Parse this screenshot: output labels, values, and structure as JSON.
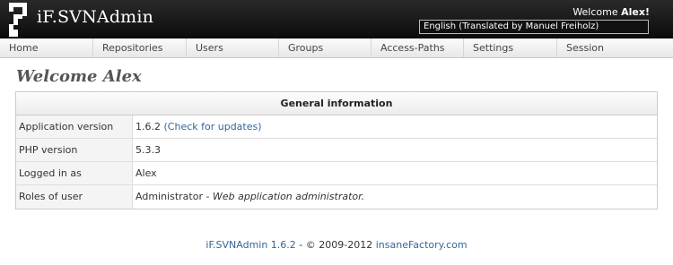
{
  "header": {
    "app_name": "iF.SVNAdmin",
    "welcome_prefix": "Welcome",
    "welcome_user": "Alex!",
    "language": "English (Translated by Manuel Freiholz)"
  },
  "nav": {
    "items": [
      {
        "label": "Home"
      },
      {
        "label": "Repositories"
      },
      {
        "label": "Users"
      },
      {
        "label": "Groups"
      },
      {
        "label": "Access-Paths"
      },
      {
        "label": "Settings"
      },
      {
        "label": "Session"
      }
    ]
  },
  "main": {
    "title": "Welcome Alex",
    "table": {
      "header": "General information",
      "rows": [
        {
          "key": "Application version",
          "value": "1.6.2",
          "link": "(Check for updates)"
        },
        {
          "key": "PHP version",
          "value": "5.3.3"
        },
        {
          "key": "Logged in as",
          "value": "Alex"
        },
        {
          "key": "Roles of user",
          "value": "Administrator",
          "separator": " - ",
          "description": "Web application administrator."
        }
      ]
    }
  },
  "footer": {
    "app_link": "iF.SVNAdmin 1.6.2",
    "separator": " - ",
    "copyright": "© 2009-2012",
    "company_link": "insaneFactory.com"
  },
  "colors": {
    "header_bg": "#111111",
    "link": "#336699",
    "title": "#555555"
  }
}
